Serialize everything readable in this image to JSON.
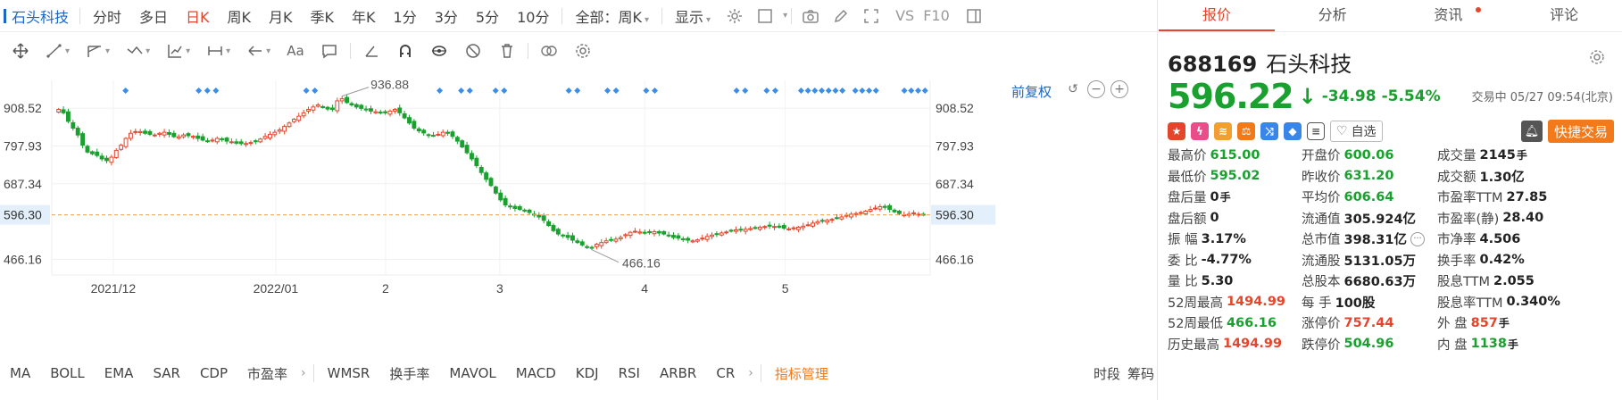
{
  "period_bar": {
    "stock_name": "石头科技",
    "items": [
      {
        "label": "分时",
        "active": false
      },
      {
        "label": "多日",
        "active": false
      },
      {
        "label": "日K",
        "active": true
      },
      {
        "label": "周K",
        "active": false
      },
      {
        "label": "月K",
        "active": false
      },
      {
        "label": "季K",
        "active": false
      },
      {
        "label": "年K",
        "active": false
      },
      {
        "label": "1分",
        "active": false
      },
      {
        "label": "3分",
        "active": false
      },
      {
        "label": "5分",
        "active": false
      },
      {
        "label": "10分",
        "active": false
      }
    ],
    "range_select": "全部：周K",
    "display_label": "显示",
    "vs_label": "VS",
    "f10_label": "F10"
  },
  "draw_bar": {
    "text_tool": "Aa"
  },
  "chart": {
    "fq_label": "前复权",
    "zoom_out": "−",
    "zoom_in": "+"
  },
  "chart_data": {
    "type": "candlestick",
    "y_ticks": [
      908.52,
      797.93,
      687.34,
      596.3,
      466.16
    ],
    "current_price": 596.3,
    "high_marker": 936.88,
    "low_marker": 466.16,
    "x_ticks": [
      "2021/12",
      "2022/01",
      "2",
      "3",
      "4",
      "5"
    ],
    "ylim": [
      420,
      990
    ],
    "accent_up": "#e3462c",
    "accent_down": "#1aa02e",
    "current_line_color": "#f0a050",
    "marker_color": "#3b8ee8",
    "close": [
      905,
      895,
      870,
      850,
      830,
      800,
      780,
      775,
      770,
      760,
      755,
      765,
      785,
      800,
      820,
      835,
      840,
      840,
      835,
      832,
      830,
      835,
      838,
      832,
      825,
      825,
      830,
      828,
      826,
      820,
      815,
      812,
      815,
      820,
      818,
      812,
      810,
      806,
      805,
      805,
      808,
      812,
      818,
      826,
      832,
      838,
      845,
      855,
      865,
      876,
      885,
      895,
      905,
      912,
      918,
      912,
      906,
      905,
      930,
      936,
      925,
      918,
      912,
      908,
      905,
      900,
      898,
      895,
      895,
      900,
      905,
      895,
      880,
      865,
      850,
      842,
      836,
      830,
      828,
      832,
      838,
      835,
      826,
      812,
      795,
      778,
      760,
      740,
      720,
      700,
      682,
      660,
      640,
      625,
      620,
      615,
      612,
      608,
      603,
      596,
      590,
      580,
      565,
      550,
      540,
      535,
      530,
      522,
      515,
      508,
      502,
      500,
      510,
      515,
      520,
      522,
      525,
      530,
      538,
      545,
      548,
      546,
      544,
      545,
      547,
      543,
      540,
      535,
      530,
      528,
      525,
      522,
      520,
      523,
      528,
      533,
      537,
      540,
      543,
      546,
      550,
      552,
      553,
      554,
      556,
      558,
      560,
      562,
      563,
      562,
      560,
      557,
      555,
      558,
      560,
      563,
      567,
      572,
      576,
      578,
      580,
      583,
      586,
      590,
      595,
      598,
      600,
      603,
      607,
      612,
      616,
      620,
      618,
      612,
      605,
      600,
      596,
      598,
      602,
      598,
      596
    ],
    "markers": [
      0.065,
      0.15,
      0.16,
      0.17,
      0.275,
      0.285,
      0.43,
      0.455,
      0.465,
      0.495,
      0.505,
      0.58,
      0.59,
      0.625,
      0.635,
      0.67,
      0.68,
      0.775,
      0.785,
      0.81,
      0.82,
      0.85,
      0.858,
      0.866,
      0.874,
      0.882,
      0.89,
      0.898,
      0.913,
      0.921,
      0.929,
      0.937,
      0.97,
      0.978,
      0.986,
      0.994
    ]
  },
  "indicators": {
    "items": [
      "MA",
      "BOLL",
      "EMA",
      "SAR",
      "CDP",
      "市盈率"
    ],
    "items2": [
      "WMSR",
      "换手率",
      "MAVOL",
      "MACD",
      "KDJ",
      "RSI",
      "ARBR",
      "CR"
    ],
    "mgmt": "指标管理",
    "right_items": [
      "时段",
      "筹码"
    ]
  },
  "tabs": [
    {
      "label": "报价",
      "active": true,
      "dot": false
    },
    {
      "label": "分析",
      "active": false,
      "dot": false
    },
    {
      "label": "资讯",
      "active": false,
      "dot": true
    },
    {
      "label": "评论",
      "active": false,
      "dot": false
    }
  ],
  "quote": {
    "code": "688169",
    "name": "石头科技",
    "price": "596.22",
    "change": "-34.98",
    "change_pct": "-5.54%",
    "status": "交易中 05/27 09:54(北京)",
    "watch_label": "自选",
    "fast_trade_label": "快捷交易",
    "rows": [
      [
        {
          "label": "最高价",
          "value": "615.00",
          "unit": "",
          "color": "green"
        },
        {
          "label": "开盘价",
          "value": "600.06",
          "unit": "",
          "color": "green"
        },
        {
          "label": "成交量",
          "value": "2145",
          "unit": "手",
          "color": "dark"
        }
      ],
      [
        {
          "label": "最低价",
          "value": "595.02",
          "unit": "",
          "color": "green"
        },
        {
          "label": "昨收价",
          "value": "631.20",
          "unit": "",
          "color": "green"
        },
        {
          "label": "成交额",
          "value": "1.30亿",
          "unit": "",
          "color": "dark"
        }
      ],
      [
        {
          "label": "盘后量",
          "value": "0",
          "unit": "手",
          "color": "dark"
        },
        {
          "label": "平均价",
          "value": "606.64",
          "unit": "",
          "color": "green"
        },
        {
          "label": "市盈率TTM",
          "value": "27.85",
          "unit": "",
          "color": "dark"
        }
      ],
      [
        {
          "label": "盘后额",
          "value": "0",
          "unit": "",
          "color": "dark"
        },
        {
          "label": "流通值",
          "value": "305.924亿",
          "unit": "",
          "color": "dark"
        },
        {
          "label": "市盈率(静)",
          "value": "28.40",
          "unit": "",
          "color": "dark"
        }
      ],
      [
        {
          "label": "振 幅",
          "value": "3.17%",
          "unit": "",
          "color": "dark"
        },
        {
          "label": "总市值",
          "value": "398.31亿",
          "unit": "",
          "color": "dark",
          "info": true
        },
        {
          "label": "市净率",
          "value": "4.506",
          "unit": "",
          "color": "dark"
        }
      ],
      [
        {
          "label": "委 比",
          "value": "-4.77%",
          "unit": "",
          "color": "dark"
        },
        {
          "label": "流通股",
          "value": "5131.05万",
          "unit": "",
          "color": "dark"
        },
        {
          "label": "换手率",
          "value": "0.42%",
          "unit": "",
          "color": "dark"
        }
      ],
      [
        {
          "label": "量 比",
          "value": "5.30",
          "unit": "",
          "color": "dark"
        },
        {
          "label": "总股本",
          "value": "6680.63万",
          "unit": "",
          "color": "dark"
        },
        {
          "label": "股息TTM",
          "value": "2.055",
          "unit": "",
          "color": "dark"
        }
      ],
      [
        {
          "label": "52周最高",
          "value": "1494.99",
          "unit": "",
          "color": "red"
        },
        {
          "label": "每 手",
          "value": "100股",
          "unit": "",
          "color": "dark"
        },
        {
          "label": "股息率TTM",
          "value": "0.340%",
          "unit": "",
          "color": "dark"
        }
      ],
      [
        {
          "label": "52周最低",
          "value": "466.16",
          "unit": "",
          "color": "green"
        },
        {
          "label": "涨停价",
          "value": "757.44",
          "unit": "",
          "color": "red"
        },
        {
          "label": "外 盘",
          "value": "857",
          "unit": "手",
          "color": "red"
        }
      ],
      [
        {
          "label": "历史最高",
          "value": "1494.99",
          "unit": "",
          "color": "red"
        },
        {
          "label": "跌停价",
          "value": "504.96",
          "unit": "",
          "color": "green"
        },
        {
          "label": "内 盘",
          "value": "1138",
          "unit": "手",
          "color": "green"
        }
      ]
    ]
  }
}
